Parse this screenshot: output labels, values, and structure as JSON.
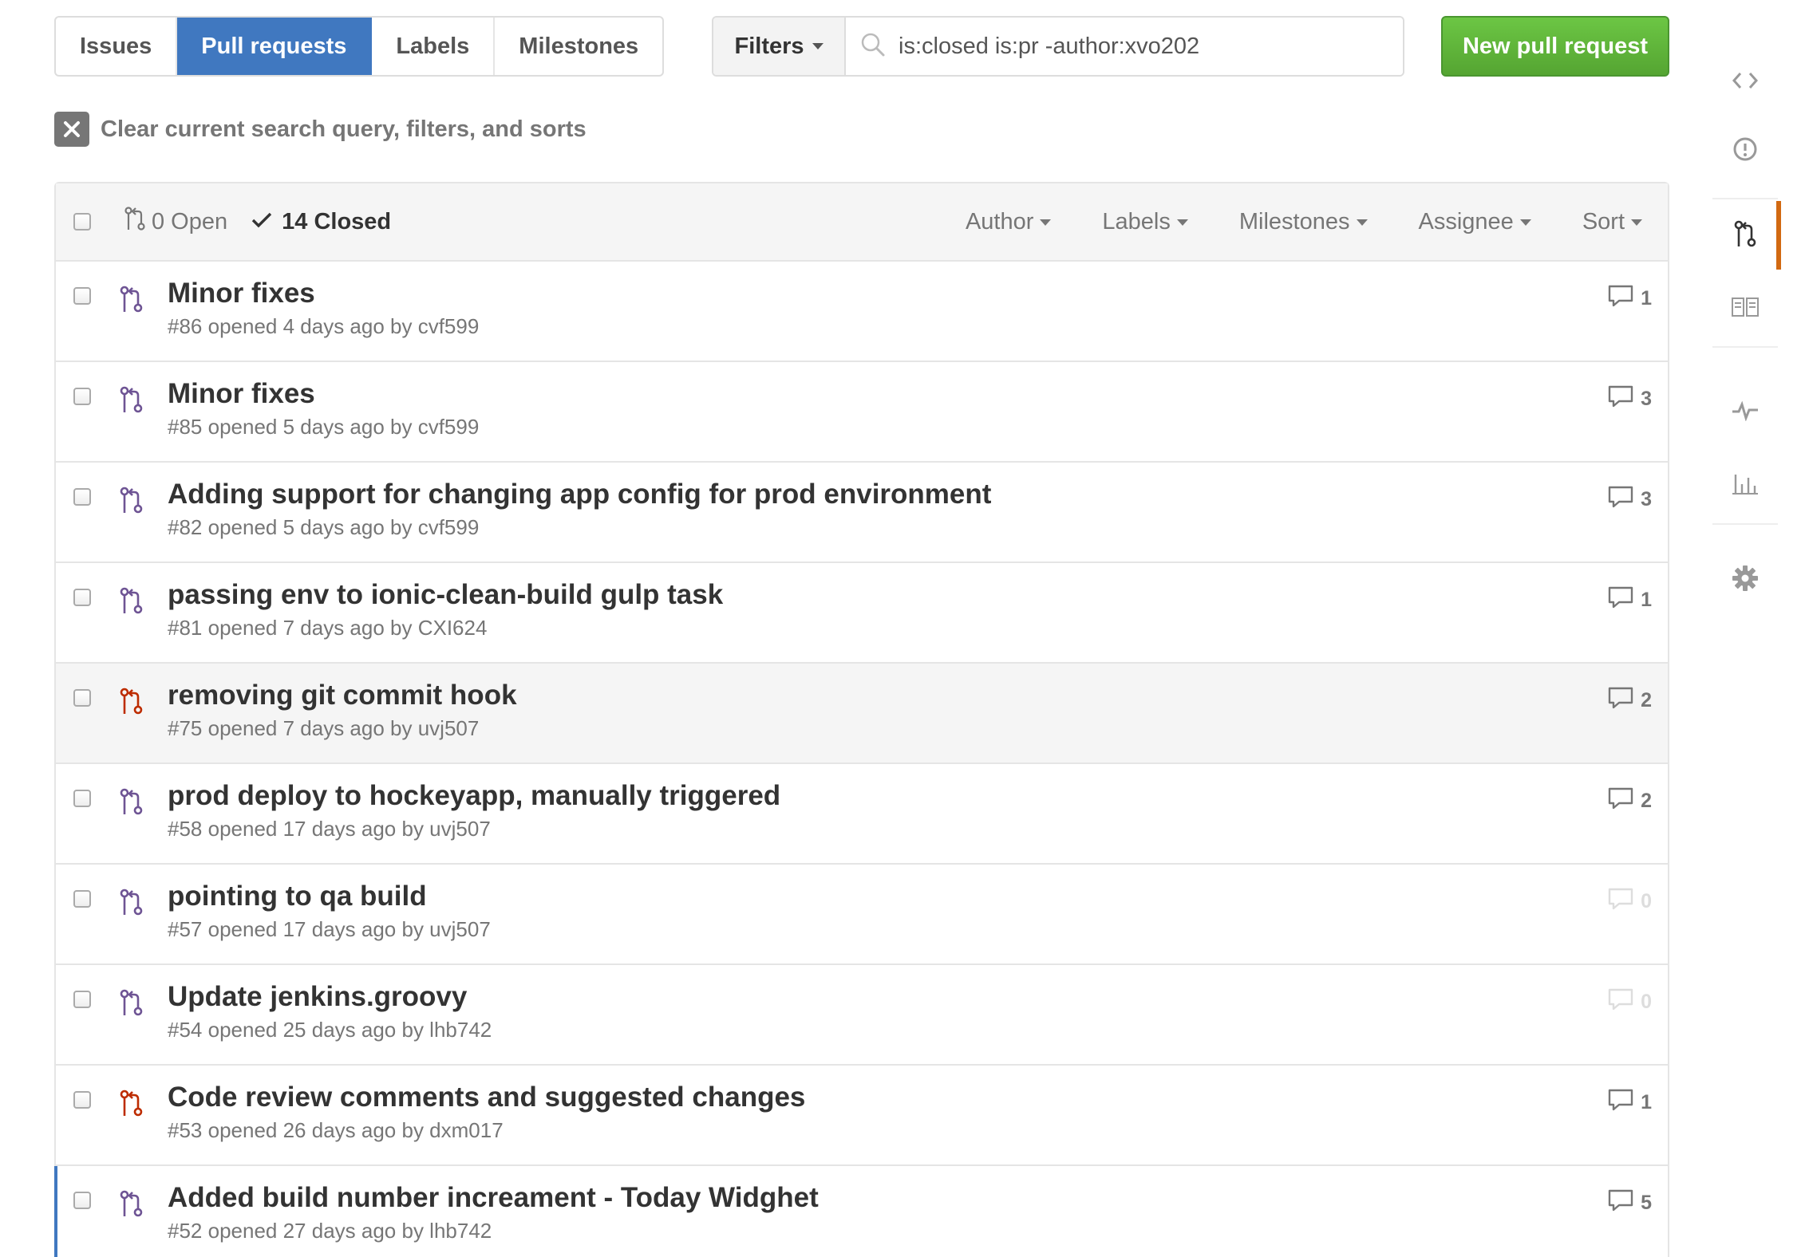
{
  "subnav": {
    "issues": "Issues",
    "pull_requests": "Pull requests",
    "labels": "Labels",
    "milestones": "Milestones"
  },
  "filters": {
    "button_label": "Filters",
    "search_value": "is:closed is:pr -author:xvo202"
  },
  "new_pr_label": "New pull request",
  "clear_label": "Clear current search query, filters, and sorts",
  "header": {
    "open_label": "0 Open",
    "closed_label": "14 Closed",
    "menus": [
      "Author",
      "Labels",
      "Milestones",
      "Assignee",
      "Sort"
    ]
  },
  "pulls": [
    {
      "title": "Minor fixes",
      "meta": "#86 opened 4 days ago by cvf599",
      "comments": "1",
      "state": "merged"
    },
    {
      "title": "Minor fixes",
      "meta": "#85 opened 5 days ago by cvf599",
      "comments": "3",
      "state": "merged"
    },
    {
      "title": "Adding support for changing app config for prod environment",
      "meta": "#82 opened 5 days ago by cvf599",
      "comments": "3",
      "state": "merged"
    },
    {
      "title": "passing env to ionic-clean-build gulp task",
      "meta": "#81 opened 7 days ago by CXI624",
      "comments": "1",
      "state": "merged"
    },
    {
      "title": "removing git commit hook",
      "meta": "#75 opened 7 days ago by uvj507",
      "comments": "2",
      "state": "closed"
    },
    {
      "title": "prod deploy to hockeyapp, manually triggered",
      "meta": "#58 opened 17 days ago by uvj507",
      "comments": "2",
      "state": "merged"
    },
    {
      "title": "pointing to qa build",
      "meta": "#57 opened 17 days ago by uvj507",
      "comments": "0",
      "state": "merged"
    },
    {
      "title": "Update jenkins.groovy",
      "meta": "#54 opened 25 days ago by lhb742",
      "comments": "0",
      "state": "merged"
    },
    {
      "title": "Code review comments and suggested changes",
      "meta": "#53 opened 26 days ago by dxm017",
      "comments": "1",
      "state": "closed"
    },
    {
      "title": "Added build number increament - Today Widghet",
      "meta": "#52 opened 27 days ago by lhb742",
      "comments": "5",
      "state": "merged"
    }
  ],
  "colors": {
    "merged": "#6e5494",
    "closed": "#bd2c00",
    "accent": "#4078c0",
    "green": "#6cc644",
    "sidenav_active": "#d26911"
  },
  "sidenav_icons": [
    "code-icon",
    "issue-icon",
    "pull-request-icon",
    "wiki-icon",
    "pulse-icon",
    "graph-icon",
    "settings-icon"
  ]
}
